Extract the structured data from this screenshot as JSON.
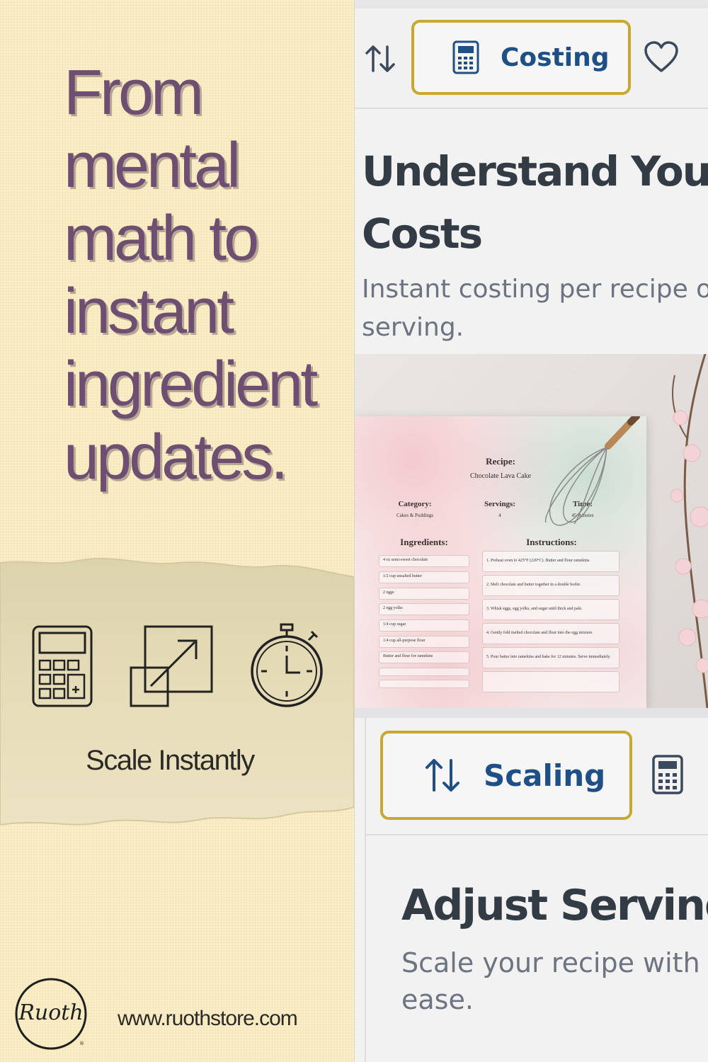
{
  "left": {
    "headline": "From\nmental\nmath to\ninstant\ningredient\nupdates.",
    "icons": [
      "calculator-icon",
      "resize-expand-icon",
      "stopwatch-icon"
    ],
    "caption": "Scale Instantly",
    "logo_text": "Ruoth",
    "website": "www.ruothstore.com"
  },
  "colors": {
    "headline": "#6e4f72",
    "tab_border": "#c9a82f",
    "tab_label": "#1e4f86"
  },
  "costing": {
    "tab_label": "Costing",
    "title_line1": "Understand Your",
    "title_line2": "Costs",
    "sub_line1": "Instant costing per recipe or",
    "sub_line2": "serving."
  },
  "recipe_card": {
    "recipe_label": "Recipe:",
    "recipe_name": "Chocolate Lava Cake",
    "category_label": "Category:",
    "category_value": "Cakes & Puddings",
    "servings_label": "Servings:",
    "servings_value": "4",
    "time_label": "Time:",
    "time_value": "45 minutes",
    "ingredients_label": "Ingredients:",
    "instructions_label": "Instructions:",
    "ingredients": [
      "4 oz semi-sweet chocolate",
      "1/2 cup unsalted butter",
      "2 eggs",
      "2 egg yolks",
      "1/4 cup sugar",
      "1/4 cup all-purpose flour",
      "Butter and flour for ramekins"
    ],
    "instructions": [
      "1. Preheat oven to 425°F (220°C). Butter and flour ramekins.",
      "2. Melt chocolate and butter together in a double boiler.",
      "3. Whisk eggs, egg yolks, and sugar until thick and pale.",
      "4. Gently fold melted chocolate and flour into the egg mixture.",
      "5. Pour batter into ramekins and bake for 12 minutes. Serve immediately."
    ]
  },
  "scaling": {
    "tab_label": "Scaling",
    "title_line1": "Adjust Servings",
    "sub_line1": "Scale your recipe with pr",
    "sub_line2": "ease."
  }
}
